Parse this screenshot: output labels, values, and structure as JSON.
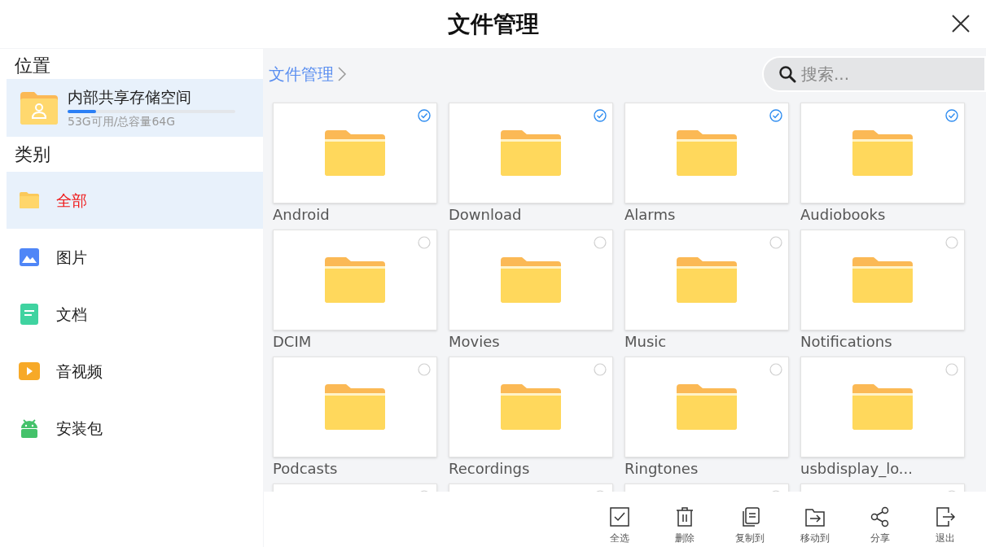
{
  "header": {
    "title": "文件管理"
  },
  "sidebar": {
    "location_heading": "位置",
    "storage": {
      "name": "内部共享存储空间",
      "level": 0.17,
      "info": "53G可用/总容量64G",
      "selected": true
    },
    "category_heading": "类别",
    "categories": [
      {
        "label": "全部",
        "kind": "folder",
        "selected": true
      },
      {
        "label": "图片",
        "kind": "image",
        "selected": false
      },
      {
        "label": "文档",
        "kind": "document",
        "selected": false
      },
      {
        "label": "音视频",
        "kind": "video",
        "selected": false
      },
      {
        "label": "安装包",
        "kind": "android",
        "selected": false
      }
    ]
  },
  "breadcrumb": {
    "label": "文件管理"
  },
  "search": {
    "placeholder": "搜索..."
  },
  "folders": [
    {
      "name": "Android",
      "selected": true
    },
    {
      "name": "Download",
      "selected": true
    },
    {
      "name": "Alarms",
      "selected": true
    },
    {
      "name": "Audiobooks",
      "selected": true
    },
    {
      "name": "DCIM",
      "selected": false
    },
    {
      "name": "Movies",
      "selected": false
    },
    {
      "name": "Music",
      "selected": false
    },
    {
      "name": "Notifications",
      "selected": false
    },
    {
      "name": "Podcasts",
      "selected": false
    },
    {
      "name": "Recordings",
      "selected": false
    },
    {
      "name": "Ringtones",
      "selected": false
    },
    {
      "name": "usbdisplay_lo...",
      "selected": false
    },
    {
      "selected": false
    },
    {
      "selected": false
    },
    {
      "selected": false
    },
    {
      "selected": false
    }
  ],
  "toolbar": [
    {
      "label": "全选",
      "kind": "select_all"
    },
    {
      "label": "删除",
      "kind": "delete"
    },
    {
      "label": "复制到",
      "kind": "copy"
    },
    {
      "label": "移动到",
      "kind": "move"
    },
    {
      "label": "分享",
      "kind": "share"
    },
    {
      "label": "退出",
      "kind": "exit"
    }
  ]
}
